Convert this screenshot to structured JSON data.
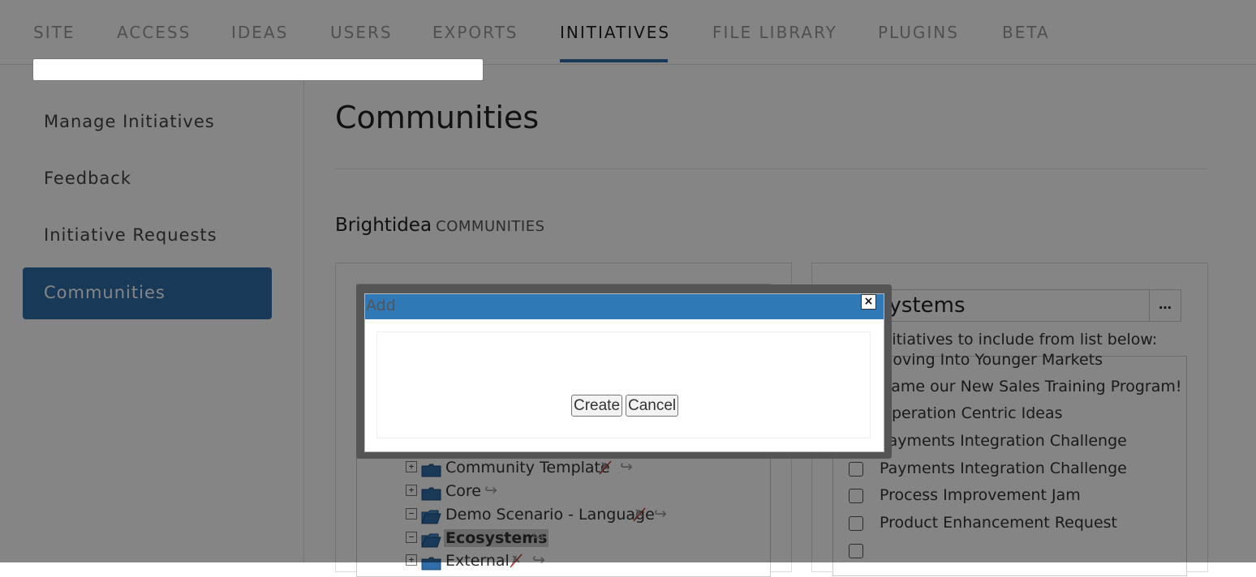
{
  "nav": {
    "tabs": [
      "SITE",
      "ACCESS",
      "IDEAS",
      "USERS",
      "EXPORTS",
      "INITIATIVES",
      "FILE LIBRARY",
      "PLUGINS",
      "BETA"
    ],
    "active": "INITIATIVES"
  },
  "sidebar": {
    "items": [
      {
        "label": "Manage Initiatives"
      },
      {
        "label": "Feedback"
      },
      {
        "label": "Initiative Requests"
      },
      {
        "label": "Communities"
      }
    ],
    "active": "Communities"
  },
  "main": {
    "title": "Communities",
    "brand": "Brightidea",
    "section": "COMMUNITIES"
  },
  "tree": {
    "items": [
      {
        "label": "Community Template",
        "toggle": "+",
        "icons": "pin-arrow"
      },
      {
        "label": "Core",
        "toggle": "+",
        "icons": "arrow"
      },
      {
        "label": "Demo Scenario - Language",
        "toggle": "−",
        "icons": "pin-arrow"
      },
      {
        "label": "Ecosystems",
        "toggle": "−",
        "icons": "arrow",
        "selected": true
      },
      {
        "label": "External",
        "toggle": "+",
        "icons": "pin-arrow"
      }
    ]
  },
  "community": {
    "name": "systems",
    "more": "…",
    "select_label": "initiatives to include from list below:",
    "initiatives": [
      "Moving Into Younger Markets",
      "Name our New Sales Training Program!",
      "Operation Centric Ideas",
      "Payments Integration Challenge",
      "Payments Integration Challenge",
      "Process Improvement Jam",
      "Product Enhancement Request",
      ""
    ]
  },
  "dialog": {
    "title": "Add",
    "close": "×",
    "input_value": "",
    "create_label": "Create",
    "cancel_label": "Cancel"
  },
  "colors": {
    "accent": "#2f6ea8",
    "dialog_title_bar": "#2f7ab6"
  }
}
